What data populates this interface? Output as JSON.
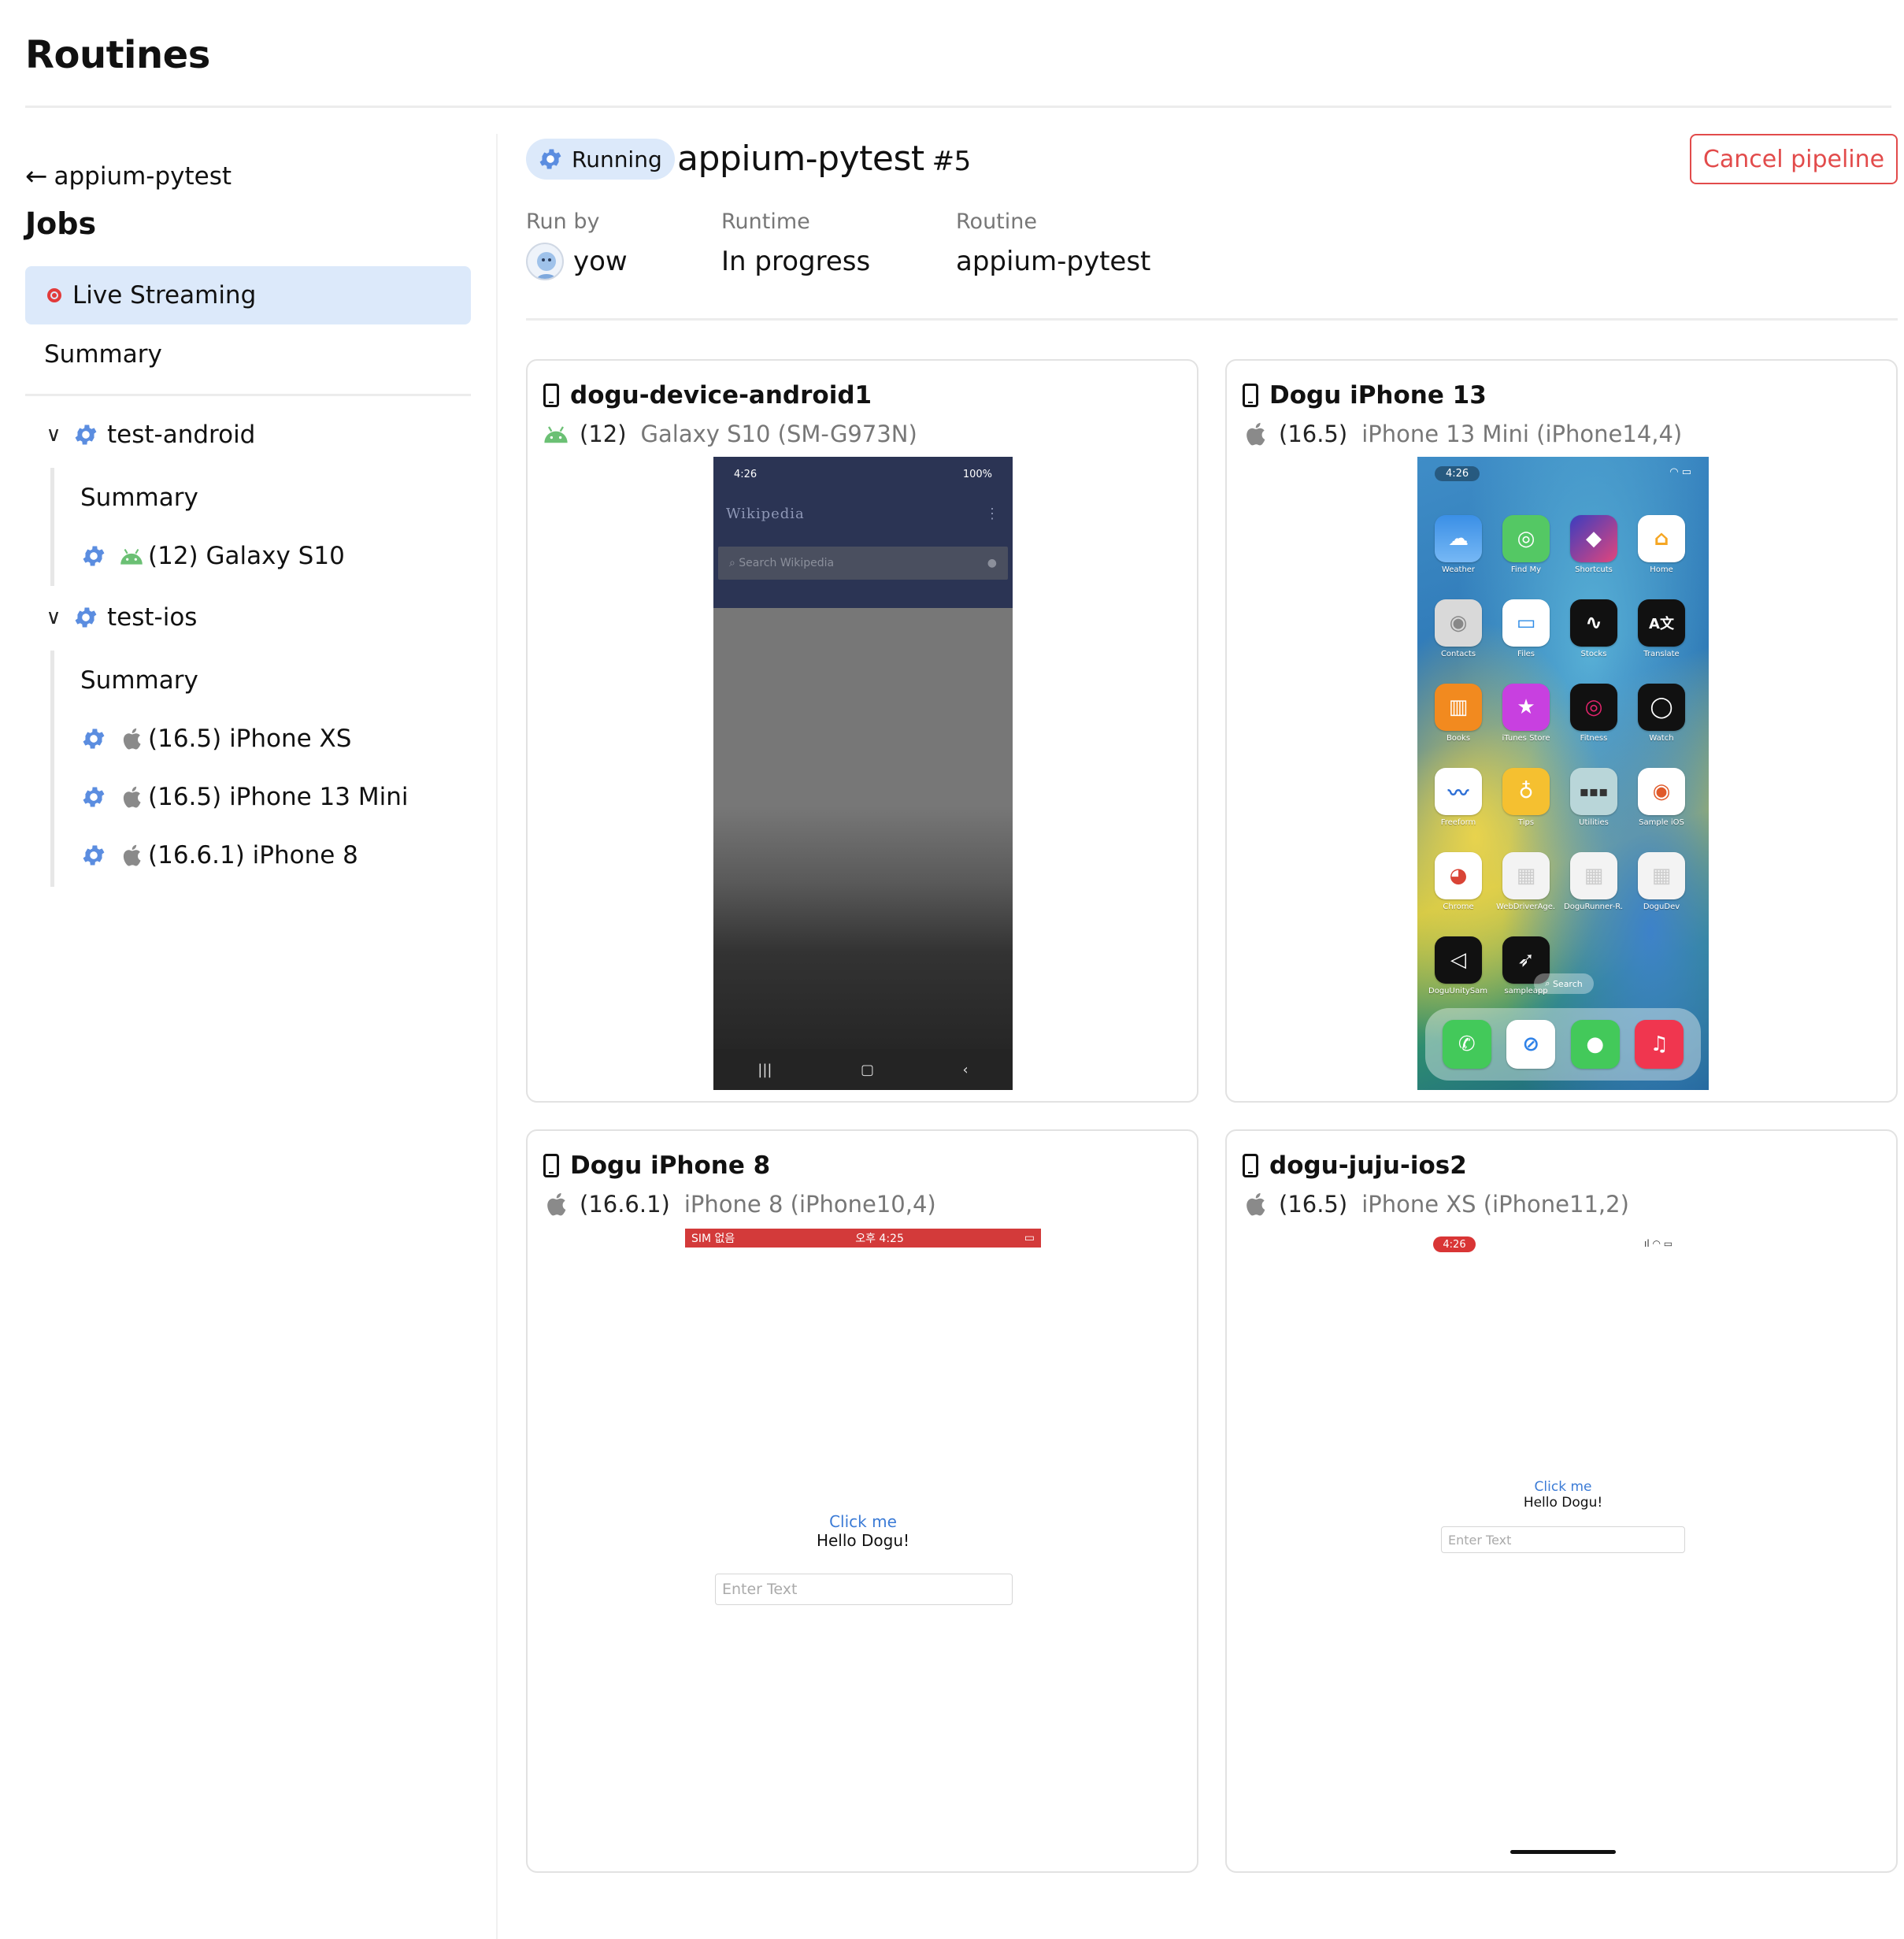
{
  "page": {
    "title": "Routines"
  },
  "sidebar": {
    "back_label": "appium-pytest",
    "jobs_title": "Jobs",
    "live_streaming_label": "Live Streaming",
    "summary_label": "Summary",
    "jobs": [
      {
        "name": "test-android",
        "summary_label": "Summary",
        "devices": [
          {
            "label": "(12) Galaxy S10",
            "os": "android"
          }
        ]
      },
      {
        "name": "test-ios",
        "summary_label": "Summary",
        "devices": [
          {
            "label": "(16.5) iPhone XS",
            "os": "ios"
          },
          {
            "label": "(16.5) iPhone 13 Mini",
            "os": "ios"
          },
          {
            "label": "(16.6.1) iPhone 8",
            "os": "ios"
          }
        ]
      }
    ]
  },
  "header": {
    "status": "Running",
    "pipeline_name": "appium-pytest",
    "pipeline_number": "#5",
    "cancel_label": "Cancel pipeline",
    "run_by_label": "Run by",
    "run_by_value": "yow",
    "runtime_label": "Runtime",
    "runtime_value": "In progress",
    "routine_label": "Routine",
    "routine_value": "appium-pytest"
  },
  "devices": [
    {
      "name": "dogu-device-android1",
      "os_version": "(12)",
      "model": "Galaxy S10 (SM-G973N)",
      "screen": {
        "status_time": "4:26",
        "status_right": "100%",
        "app_title": "Wikipedia",
        "search_placeholder": "Search Wikipedia"
      }
    },
    {
      "name": "Dogu iPhone 13",
      "os_version": "(16.5)",
      "model": "iPhone 13 Mini (iPhone14,4)",
      "screen": {
        "status_time": "4:26",
        "apps": [
          "Weather",
          "Find My",
          "Shortcuts",
          "Home",
          "Contacts",
          "Files",
          "Stocks",
          "Translate",
          "Books",
          "iTunes Store",
          "Fitness",
          "Watch",
          "Freeform",
          "Tips",
          "Utilities",
          "Sample iOS",
          "Chrome",
          "WebDriverAge...",
          "DoguRunner-R...",
          "DoguDev",
          "DoguUnitySample",
          "sampleapp"
        ],
        "search_label": "Search"
      }
    },
    {
      "name": "Dogu iPhone 8",
      "os_version": "(16.6.1)",
      "model": "iPhone 8 (iPhone10,4)",
      "screen": {
        "status_left": "SIM 없음",
        "status_center": "오후 4:25",
        "click_me": "Click me",
        "hello": "Hello Dogu!",
        "input_placeholder": "Enter Text"
      }
    },
    {
      "name": "dogu-juju-ios2",
      "os_version": "(16.5)",
      "model": "iPhone XS (iPhone11,2)",
      "screen": {
        "status_time": "4:26",
        "click_me": "Click me",
        "hello": "Hello Dogu!",
        "input_placeholder": "Enter Text"
      }
    }
  ],
  "colors": {
    "accent": "#4a7fd8",
    "danger": "#e24b4b",
    "selected_bg": "#dce9fa",
    "android_green": "#6bc074",
    "apple_gray": "#888888"
  }
}
